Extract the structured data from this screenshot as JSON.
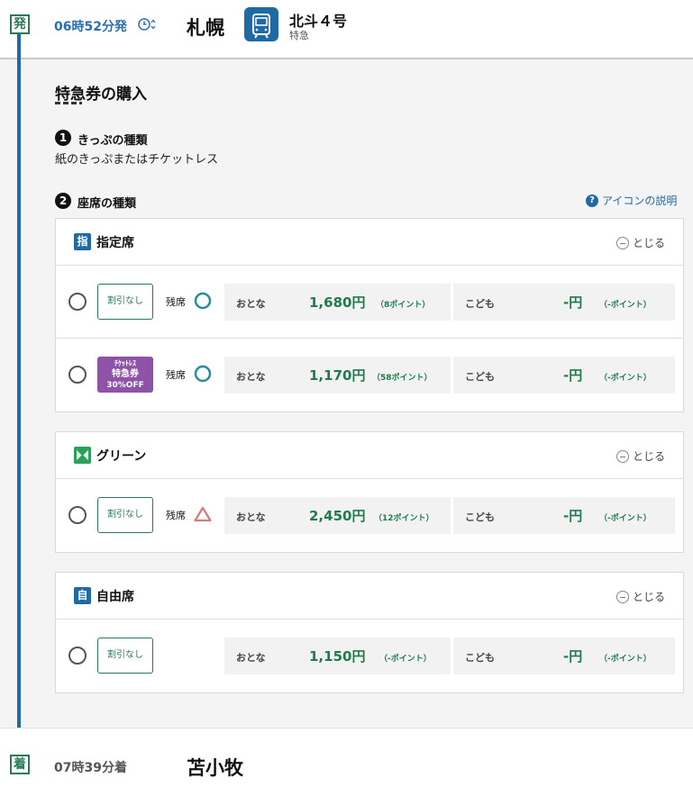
{
  "departure": {
    "badge": "発",
    "time": "06時52分発",
    "station": "札幌",
    "train_name": "北斗４号",
    "train_type": "特急"
  },
  "arrival": {
    "badge": "着",
    "time": "07時39分着",
    "station": "苫小牧"
  },
  "section": {
    "title": "特急券の購入",
    "step1_num": "1",
    "step1_label": "きっぷの種類",
    "step1_value": "紙のきっぷまたはチケットレス",
    "step2_num": "2",
    "step2_label": "座席の種類",
    "help_link": "アイコンの説明",
    "help_icon_glyph": "?"
  },
  "labels": {
    "close": "とじる",
    "adult": "おとな",
    "child": "こども",
    "availability": "残席"
  },
  "seat_classes": [
    {
      "title": "指定席",
      "icon_glyph": "指",
      "icon_color": "#1f6aa5",
      "rows": [
        {
          "discount": "割引なし",
          "availability": "circle",
          "adult_price": "1,680円",
          "adult_points": "（8ポイント）",
          "child_price": "-円",
          "child_points": "（-ポイント）"
        },
        {
          "badge": [
            "ﾁｹｯﾄﾚｽ",
            "特急券",
            "30%OFF"
          ],
          "availability": "circle",
          "adult_price": "1,170円",
          "adult_points": "（58ポイント）",
          "child_price": "-円",
          "child_points": "（-ポイント）"
        }
      ]
    },
    {
      "title": "グリーン",
      "icon_color": "#2aa05a",
      "rows": [
        {
          "discount": "割引なし",
          "availability": "triangle",
          "adult_price": "2,450円",
          "adult_points": "（12ポイント）",
          "child_price": "-円",
          "child_points": "（-ポイント）"
        }
      ]
    },
    {
      "title": "自由席",
      "icon_glyph": "自",
      "icon_color": "#1f6aa5",
      "rows": [
        {
          "discount": "割引なし",
          "adult_price": "1,150円",
          "adult_points": "（-ポイント）",
          "child_price": "-円",
          "child_points": "（-ポイント）"
        }
      ]
    }
  ],
  "colors": {
    "accent_blue": "#1f6aa5",
    "price_green": "#1f7a4d",
    "avail_circle": "#2a8aa0",
    "avail_triangle": "#d9777a",
    "ticketless_purple": "#8e52a6"
  }
}
